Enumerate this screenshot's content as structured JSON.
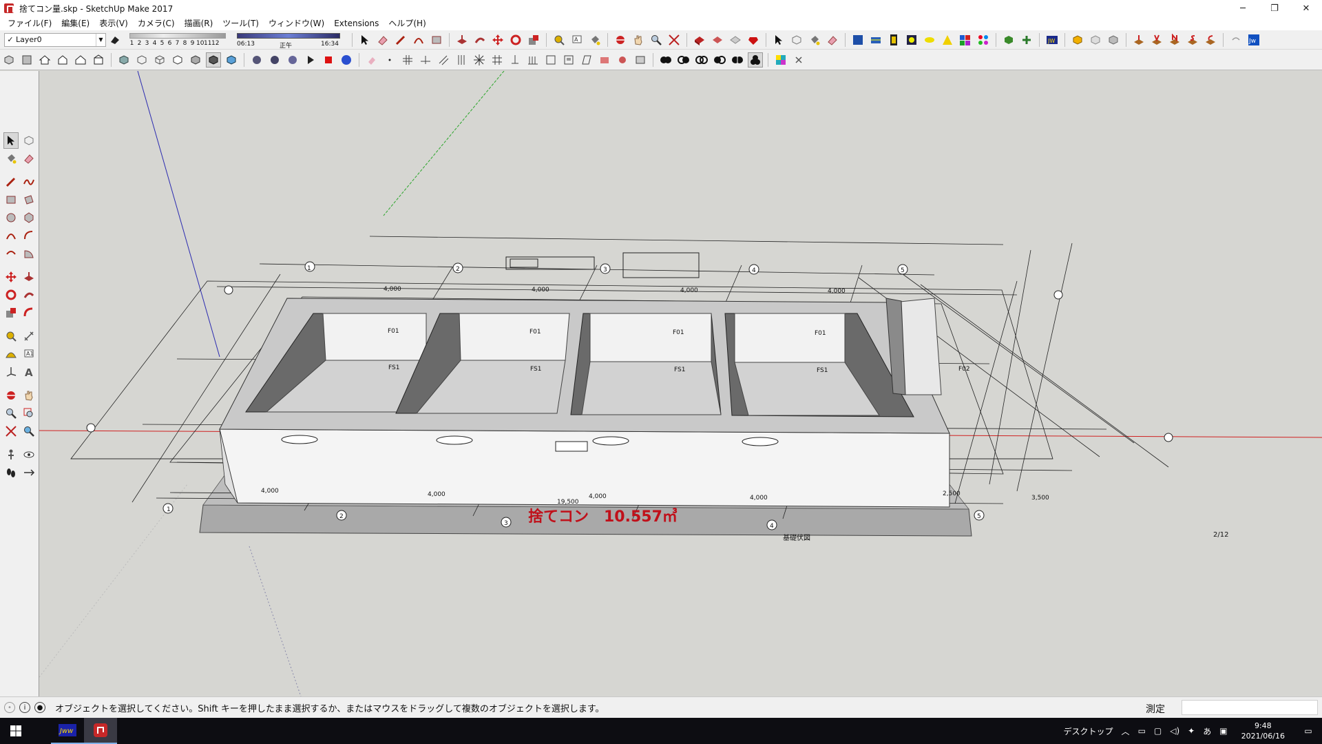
{
  "window": {
    "title": "捨てコン量.skp - SketchUp Make 2017",
    "controls": [
      "─",
      "❐",
      "✕"
    ]
  },
  "menu": [
    "ファイル(F)",
    "編集(E)",
    "表示(V)",
    "カメラ(C)",
    "描画(R)",
    "ツール(T)",
    "ウィンドウ(W)",
    "Extensions",
    "ヘルプ(H)"
  ],
  "layer": {
    "check": "✓",
    "value": "Layer0"
  },
  "shadows": {
    "months": [
      "1",
      "2",
      "3",
      "4",
      "5",
      "6",
      "7",
      "8",
      "9",
      "10",
      "11",
      "12"
    ],
    "time_start": "06:13",
    "noon": "正午",
    "time_end": "16:34"
  },
  "model": {
    "annotation": "捨てコン　10.557㎥",
    "plan_title": "基礎伏図",
    "page_number": "2/12",
    "grid_numbers": [
      "1",
      "2",
      "3",
      "4",
      "5"
    ],
    "dims_front": [
      "4,000",
      "4,000",
      "4,000",
      "4,000",
      "2,500",
      "3,500"
    ],
    "dim_total": "19,500",
    "dims_back": [
      "4,000",
      "4,000",
      "4,000",
      "4,000"
    ],
    "footings": [
      "FS1",
      "FS1",
      "FS1",
      "FS1",
      "F01",
      "F01",
      "F01",
      "F01",
      "F02"
    ]
  },
  "statusbar": {
    "message": "オブジェクトを選択してください。Shift キーを押したまま選択するか、またはマウスをドラッグして複数のオブジェクトを選択します。",
    "measure_label": "測定",
    "measure_value": ""
  },
  "taskbar": {
    "apps": [
      "Jww",
      "SketchUp"
    ],
    "desktop_label": "デスクトップ",
    "ime": "あ",
    "time": "9:48",
    "date": "2021/06/16"
  },
  "colors": {
    "annotation_red": "#c0101a",
    "axis_red": "#d02020",
    "axis_green": "#2aa52a",
    "axis_blue": "#2a2ab0",
    "viewport_bg": "#d6d6d2"
  }
}
